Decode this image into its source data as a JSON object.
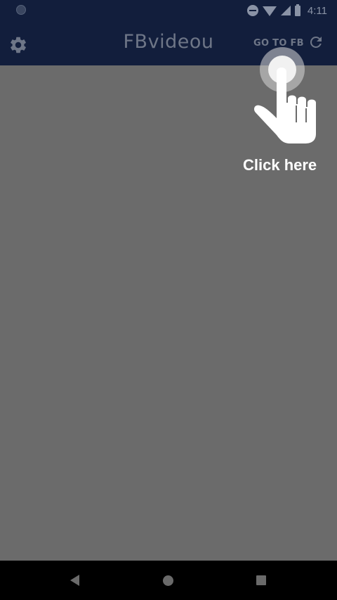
{
  "status_bar": {
    "time": "4:11",
    "icons": [
      "notification-dot-icon",
      "do-not-disturb-icon",
      "wifi-icon",
      "signal-icon",
      "battery-icon"
    ]
  },
  "app_bar": {
    "title": "FBvideou",
    "go_to_fb_label": "GO TO FB",
    "settings_icon": "gear-icon",
    "refresh_icon": "refresh-icon",
    "background_color": "#121e3c"
  },
  "overlay": {
    "hint_text": "Click here",
    "pointer_icon": "hand-pointer-icon"
  },
  "content": {
    "background_color": "#6b6b6b"
  },
  "nav_bar": {
    "icons": [
      "back-icon",
      "home-icon",
      "recents-icon"
    ]
  }
}
